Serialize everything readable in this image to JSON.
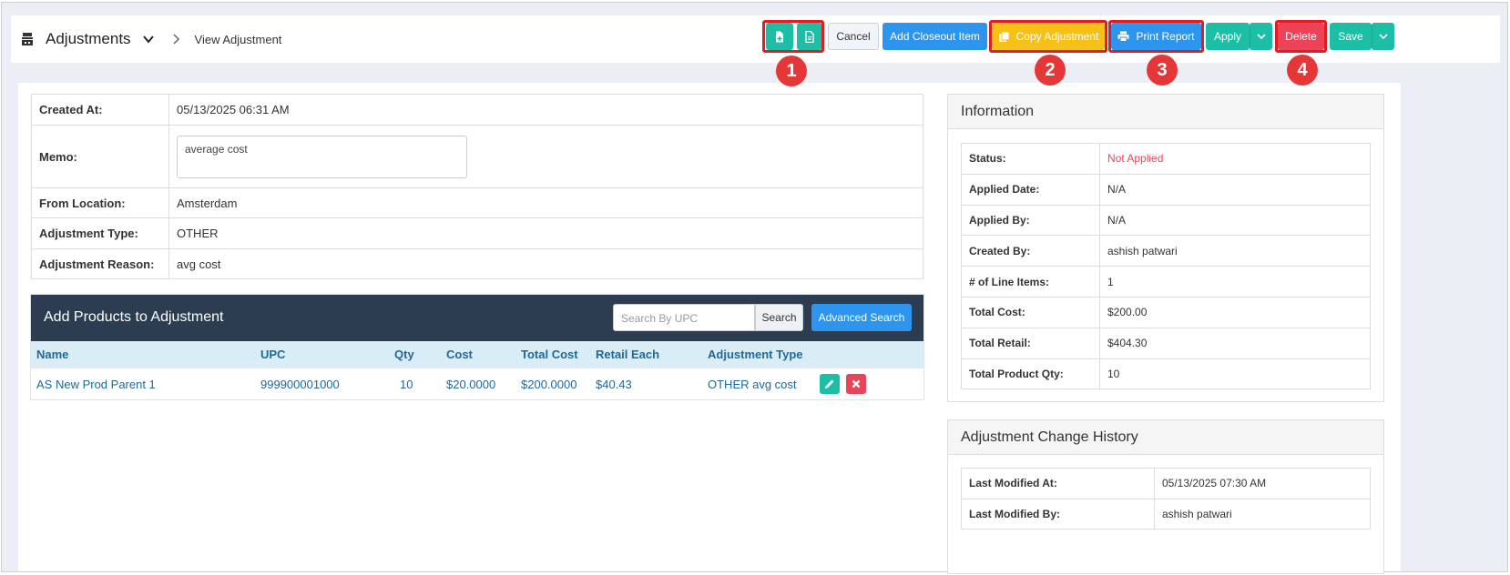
{
  "header": {
    "module_title": "Adjustments",
    "breadcrumb_current": "View Adjustment"
  },
  "toolbar": {
    "cancel_label": "Cancel",
    "add_closeout_label": "Add Closeout Item",
    "copy_adjustment_label": "Copy Adjustment",
    "print_report_label": "Print Report",
    "apply_label": "Apply",
    "delete_label": "Delete",
    "save_label": "Save"
  },
  "markers": [
    "1",
    "2",
    "3",
    "4"
  ],
  "details": {
    "created_at_label": "Created At:",
    "created_at": "05/13/2025 06:31 AM",
    "memo_label": "Memo:",
    "memo": "average cost",
    "from_location_label": "From Location:",
    "from_location": "Amsterdam",
    "adjustment_type_label": "Adjustment Type:",
    "adjustment_type": "OTHER",
    "adjustment_reason_label": "Adjustment Reason:",
    "adjustment_reason": "avg cost"
  },
  "add_products": {
    "title": "Add Products to Adjustment",
    "search_placeholder": "Search By UPC",
    "search_label": "Search",
    "advanced_search_label": "Advanced Search",
    "columns": [
      "Name",
      "UPC",
      "Qty",
      "Cost",
      "Total Cost",
      "Retail Each",
      "Adjustment Type"
    ],
    "rows": [
      {
        "name": "AS New Prod Parent 1",
        "upc": "999900001000",
        "qty": "10",
        "cost": "$20.0000",
        "total_cost": "$200.0000",
        "retail_each": "$40.43",
        "adjustment_type": "OTHER avg cost"
      }
    ]
  },
  "information": {
    "title": "Information",
    "status_label": "Status:",
    "status": "Not Applied",
    "applied_date_label": "Applied Date:",
    "applied_date": "N/A",
    "applied_by_label": "Applied By:",
    "applied_by": "N/A",
    "created_by_label": "Created By:",
    "created_by": "ashish patwari",
    "line_items_label": "# of Line Items:",
    "line_items": "1",
    "total_cost_label": "Total Cost:",
    "total_cost": "$200.00",
    "total_retail_label": "Total Retail:",
    "total_retail": "$404.30",
    "total_qty_label": "Total Product Qty:",
    "total_qty": "10"
  },
  "history": {
    "title": "Adjustment Change History",
    "last_modified_at_label": "Last Modified At:",
    "last_modified_at": "05/13/2025 07:30 AM",
    "last_modified_by_label": "Last Modified By:",
    "last_modified_by": "ashish patwari"
  },
  "colors": {
    "teal": "#1cbfa6",
    "blue": "#2d95ee",
    "yellow": "#f6c017",
    "red": "#ed4358",
    "navy_header": "#2d3d51",
    "status_red": "#ed4358",
    "highlight": "#e11c23"
  }
}
